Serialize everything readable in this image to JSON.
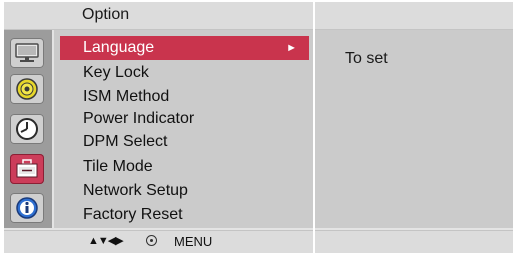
{
  "header": {
    "title": "Option"
  },
  "sidebar": {
    "icons": [
      {
        "name": "monitor-icon"
      },
      {
        "name": "audio-disc-icon"
      },
      {
        "name": "clock-icon"
      },
      {
        "name": "toolbox-icon",
        "active": true
      },
      {
        "name": "info-icon"
      }
    ]
  },
  "menu": {
    "items": [
      {
        "label": "Language",
        "selected": true
      },
      {
        "label": "Key Lock"
      },
      {
        "label": "ISM Method"
      },
      {
        "label": "Power Indicator"
      },
      {
        "label": "DPM Select"
      },
      {
        "label": "Tile Mode"
      },
      {
        "label": "Network Setup"
      },
      {
        "label": "Factory Reset"
      }
    ],
    "submenu_arrow": "►"
  },
  "description": {
    "text": "To set"
  },
  "footer": {
    "nav_arrows": "▲▼◀▶",
    "menu_label": "MENU"
  },
  "colors": {
    "selected": "#c9344d",
    "panel": "#cbcbcb",
    "header": "#dcdcdc"
  }
}
